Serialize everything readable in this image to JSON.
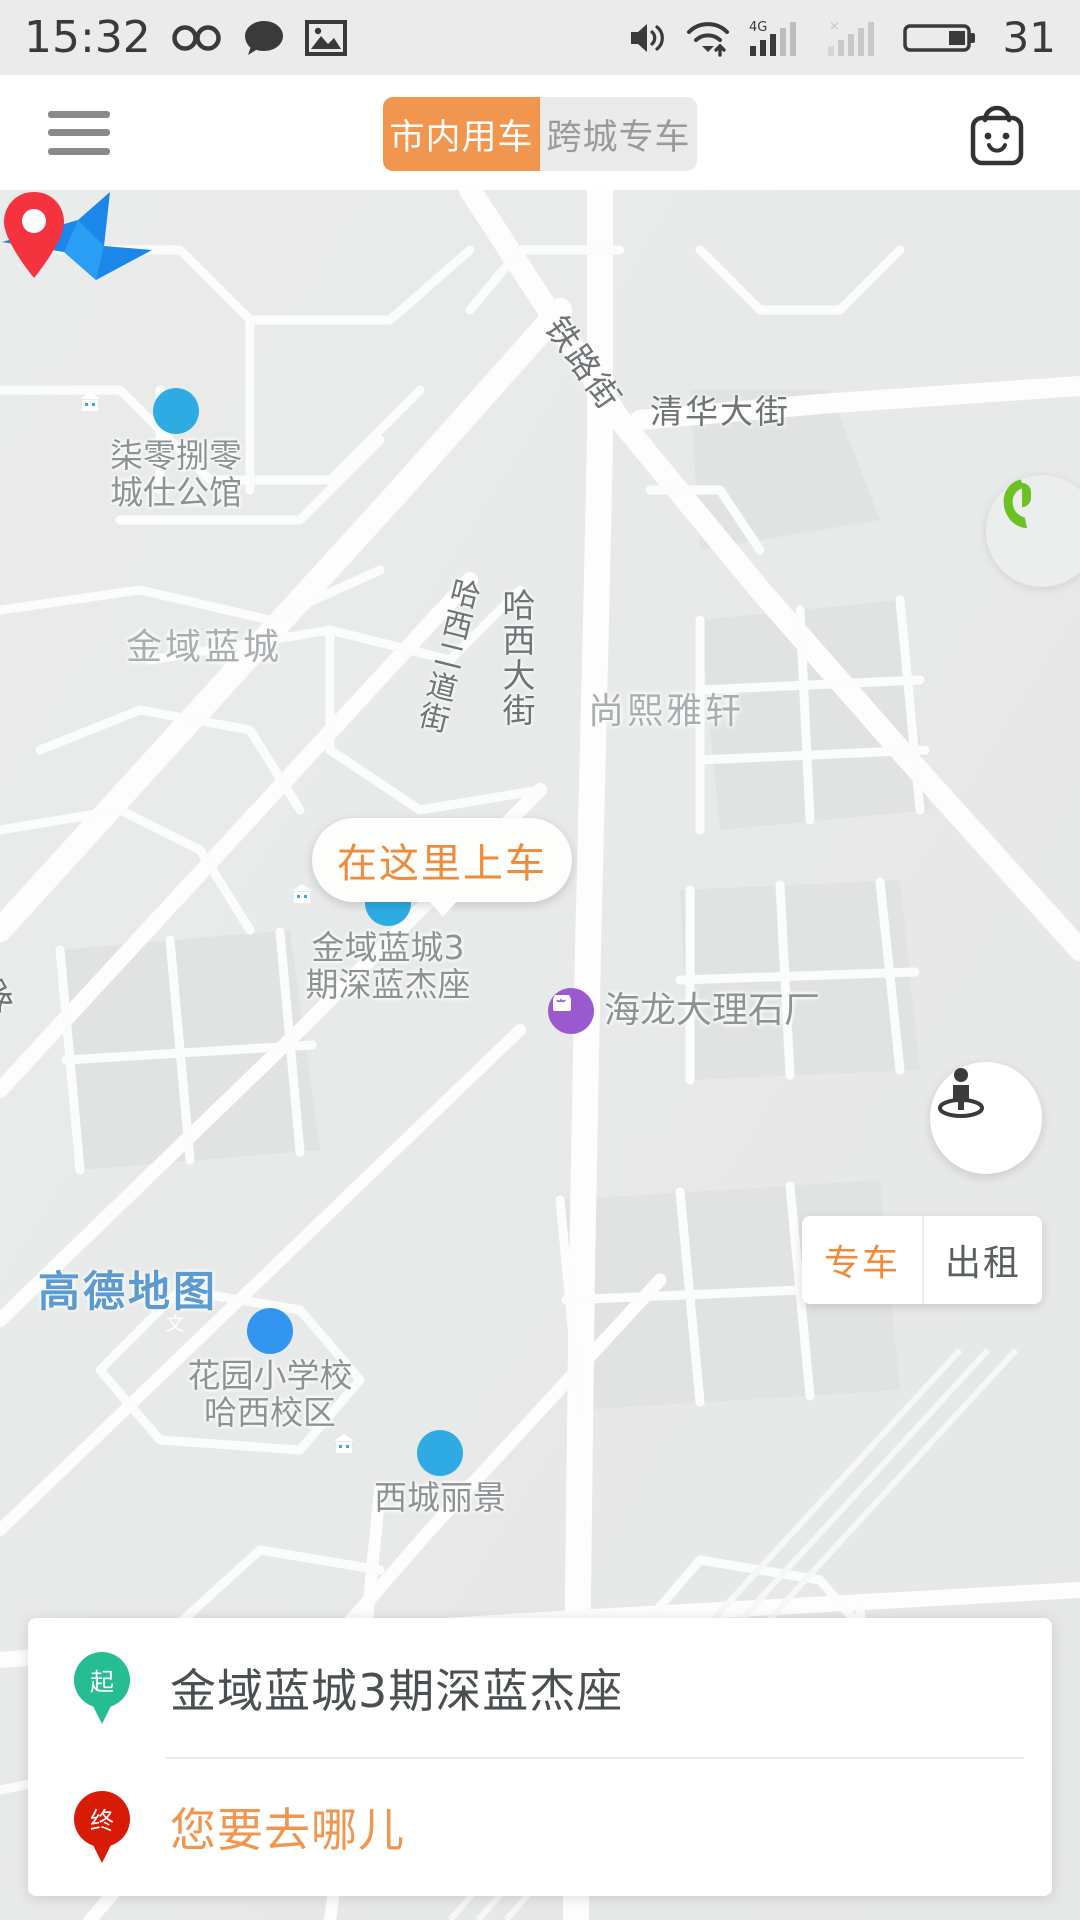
{
  "status_bar": {
    "time": "15:32",
    "battery_percent": "31",
    "network_label": "4G",
    "icons": [
      "infinity-icon",
      "message-icon",
      "photo-icon",
      "sound-icon",
      "wifi-icon",
      "signal-4g-icon",
      "signal-disabled-icon",
      "battery-icon"
    ]
  },
  "header": {
    "menu_icon": "hamburger-menu-icon",
    "tabs": [
      {
        "label": "市内用车",
        "active": true
      },
      {
        "label": "跨城专车",
        "active": false
      }
    ],
    "shop_icon": "shopping-bag-smiley-icon",
    "active_tab_color": "#f0964f",
    "inactive_tab_bg": "#ebebeb"
  },
  "map": {
    "callout": "在这里上车",
    "callout_color": "#ef8c3c",
    "watermark": "高德地图",
    "watermark_color": "#5b9bd0",
    "my_location_marker": "red-location-pin",
    "heading_marker": "blue-direction-arrow",
    "streets": [
      {
        "name": "铁路街",
        "orientation": "diagonal"
      },
      {
        "name": "清华大街",
        "orientation": "horizontal"
      },
      {
        "name": "哈西大街",
        "orientation": "vertical"
      },
      {
        "name": "哈西二道街",
        "orientation": "vertical"
      },
      {
        "name": "威路",
        "orientation": "diagonal"
      }
    ],
    "area_labels": [
      "金域蓝城",
      "尚熙雅轩"
    ],
    "pois": [
      {
        "name": "柒零捌零\n城仕公馆",
        "line1": "柒零捌零",
        "line2": "城仕公馆",
        "icon": "building-icon",
        "color": "#2fabe3"
      },
      {
        "name": "金域蓝城3期深蓝杰座",
        "line1": "金域蓝城3",
        "line2": "期深蓝杰座",
        "icon": "building-icon",
        "color": "#2fabe3"
      },
      {
        "name": "海龙大理石厂",
        "line1": "海龙大理石厂",
        "line2": "",
        "icon": "shop-icon",
        "color": "#9b59d0"
      },
      {
        "name": "花园小学校哈西校区",
        "line1": "花园小学校",
        "line2": "哈西校区",
        "icon": "education-icon",
        "color": "#3296f0"
      },
      {
        "name": "西城丽景",
        "line1": "西城丽景",
        "line2": "",
        "icon": "building-icon",
        "color": "#2fabe3"
      }
    ],
    "call_button_icon": "phone-handset-icon",
    "streetview_button_icon": "street-view-person-icon",
    "car_type_toggle": [
      {
        "label": "专车",
        "active": true
      },
      {
        "label": "出租",
        "active": false
      }
    ]
  },
  "booking_card": {
    "start": {
      "badge": "起",
      "value": "金域蓝城3期深蓝杰座",
      "badge_color": "#27bd93"
    },
    "end": {
      "badge": "终",
      "placeholder": "您要去哪儿",
      "badge_color": "#d81b06",
      "placeholder_color": "#f0964f"
    }
  }
}
